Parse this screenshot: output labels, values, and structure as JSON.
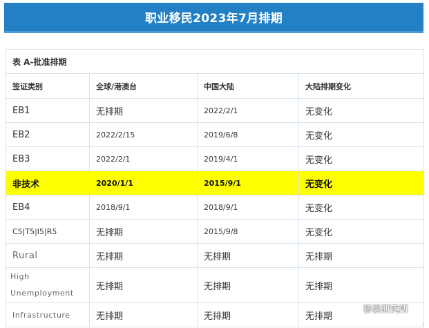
{
  "header": {
    "title": "职业移民2023年7月排期"
  },
  "table": {
    "caption": "表 A-批准排期",
    "columns": [
      "签证类别",
      "全球/港澳台",
      "中国大陆",
      "大陆排期变化"
    ],
    "rows": [
      [
        "EB1",
        "无排期",
        "2022/2/1",
        "无变化"
      ],
      [
        "EB2",
        "2022/2/15",
        "2019/6/8",
        "无变化"
      ],
      [
        "EB3",
        "2022/2/1",
        "2019/4/1",
        "无变化"
      ],
      [
        "非技术",
        "2020/1/1",
        "2015/9/1",
        "无变化"
      ],
      [
        "EB4",
        "2018/9/1",
        "2018/9/1",
        "无变化"
      ],
      [
        "C5|T5|I5|R5",
        "无排期",
        "2015/9/8",
        "无变化"
      ],
      [
        "Rural",
        "无排期",
        "无排期",
        "无排期"
      ],
      [
        "High Unemployment",
        "无排期",
        "无排期",
        "无排期"
      ],
      [
        "Infrastructure",
        "无排期",
        "无排期",
        "无排期"
      ]
    ],
    "highlight_color": "#ffff00"
  },
  "watermark": {
    "text": "移民研究所",
    "icon": "wechat-icon"
  },
  "colors": {
    "banner": "#2480c5",
    "border": "#d7e3ee"
  }
}
